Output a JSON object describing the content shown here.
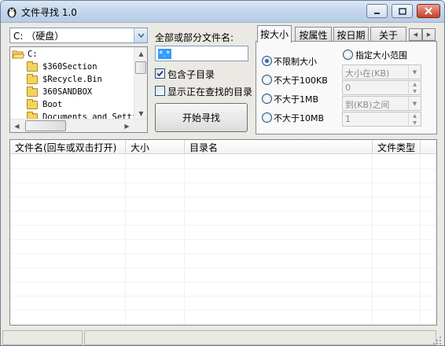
{
  "window": {
    "title": "文件寻找 1.0"
  },
  "drive": {
    "selected": "C: （硬盘）"
  },
  "tree": {
    "items": [
      "C:",
      "$360Section",
      "$Recycle.Bin",
      "360SANDBOX",
      "Boot",
      "Documents and Setti"
    ]
  },
  "search": {
    "name_label": "全部或部分文件名:",
    "name_value": "*.*",
    "include_subdirs": "包含子目录",
    "show_current_dir": "显示正在查找的目录",
    "start_button": "开始寻找"
  },
  "tabs": [
    "按大小",
    "按属性",
    "按日期",
    "关于"
  ],
  "size_tab": {
    "options": [
      "不限制大小",
      "不大于100KB",
      "不大于1MB",
      "不大于10MB"
    ],
    "specify_range": "指定大小范围",
    "size_in_placeholder": "大小在(KB)",
    "from_value": "0",
    "to_label": "到(KB)之间",
    "to_value": "1"
  },
  "results": {
    "columns": [
      "文件名(回车或双击打开)",
      "大小",
      "目录名",
      "文件类型"
    ]
  },
  "colors": {
    "accent": "#3399ff",
    "title_bar": "#c4d6ec",
    "face": "#ebe9e4"
  }
}
